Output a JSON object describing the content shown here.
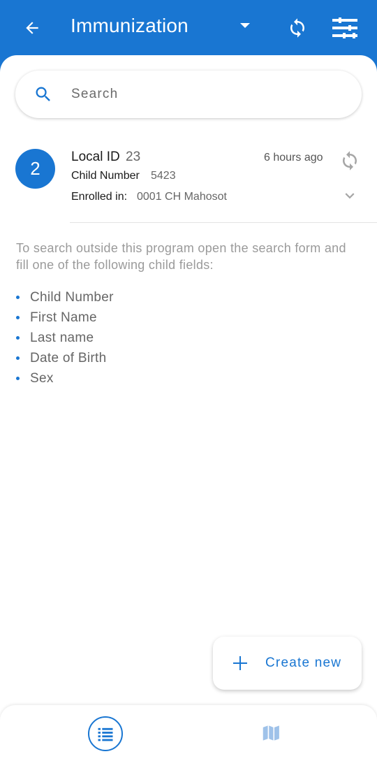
{
  "header": {
    "title": "Immunization",
    "color": "#1976d2"
  },
  "search": {
    "placeholder": "Search",
    "value": ""
  },
  "card": {
    "avatar_text": "2",
    "local_id_label": "Local ID",
    "local_id_value": "23",
    "child_number_label": "Child Number",
    "child_number_value": "5423",
    "enrolled_label": "Enrolled in:",
    "enrolled_value": "0001 CH Mahosot",
    "time_ago": "6 hours ago"
  },
  "hint": {
    "text": "To search outside this program open the search form and fill one of the following child fields:",
    "fields": [
      "Child Number",
      "First Name",
      "Last name",
      "Date of Birth",
      "Sex"
    ]
  },
  "fab": {
    "label": "Create new"
  },
  "bottom_nav": {
    "items": [
      {
        "icon": "list-icon",
        "active": true
      },
      {
        "icon": "map-icon",
        "active": false
      }
    ]
  }
}
